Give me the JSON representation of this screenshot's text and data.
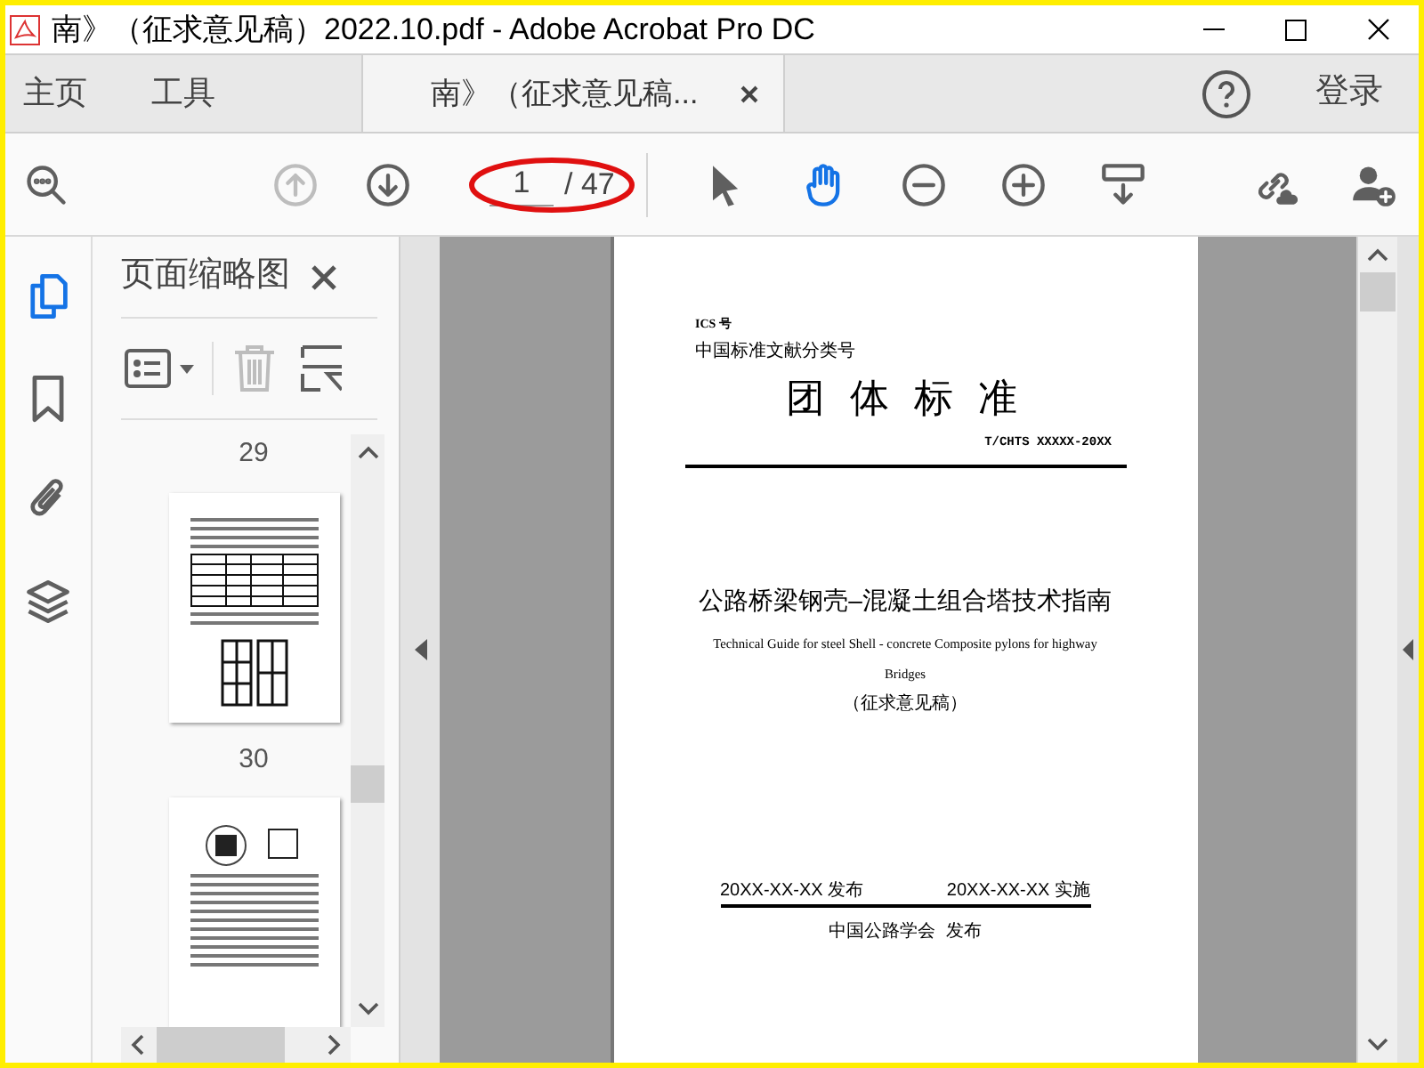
{
  "window": {
    "title": "南》（征求意见稿）2022.10.pdf - Adobe Acrobat Pro DC"
  },
  "nav_tabs": [
    {
      "label": "主页",
      "selected": false
    },
    {
      "label": "工具",
      "selected": false
    },
    {
      "label": "南》（征求意见稿...",
      "selected": true
    }
  ],
  "sign_in": "登录",
  "toolbar_left": [
    {
      "kind": "zoom-search"
    },
    {
      "kind": "prev-page",
      "disabled": true
    },
    {
      "kind": "next-page",
      "disabled": false
    }
  ],
  "page_nav": {
    "current": "1",
    "total": "/ 47",
    "circled": true
  },
  "toolbar_tools": [
    {
      "kind": "select",
      "selected": false
    },
    {
      "kind": "hand",
      "selected": true
    },
    {
      "kind": "zoom-out"
    },
    {
      "kind": "zoom-in"
    },
    {
      "kind": "scroll-mode"
    }
  ],
  "toolbar_right": [
    {
      "kind": "share-link"
    },
    {
      "kind": "add-user"
    }
  ],
  "rail": [
    {
      "kind": "pages",
      "selected": true
    },
    {
      "kind": "bookmarks",
      "selected": false
    },
    {
      "kind": "attachments",
      "selected": false
    },
    {
      "kind": "layers",
      "selected": false
    }
  ],
  "thumbnails_panel": {
    "title": "页面缩略图",
    "delete_disabled": true,
    "items": [
      {
        "kind": "label",
        "text": "29"
      },
      {
        "kind": "page"
      },
      {
        "kind": "label",
        "text": "30"
      },
      {
        "kind": "page"
      }
    ]
  },
  "document": {
    "ics": "ICS 号",
    "classification": "中国标准文献分类号",
    "heading": "团 体 标 准",
    "code": "T/CHTS XXXXX-20XX",
    "title": "公路桥梁钢壳–混凝土组合塔技术指南",
    "english_title": "Technical Guide for steel Shell - concrete Composite pylons for highway Bridges",
    "draft": "（征求意见稿）",
    "issue_date": "20XX-XX-XX 发布",
    "effective_date": "20XX-XX-XX 实施",
    "publisher": "中国公路学会  发布"
  }
}
